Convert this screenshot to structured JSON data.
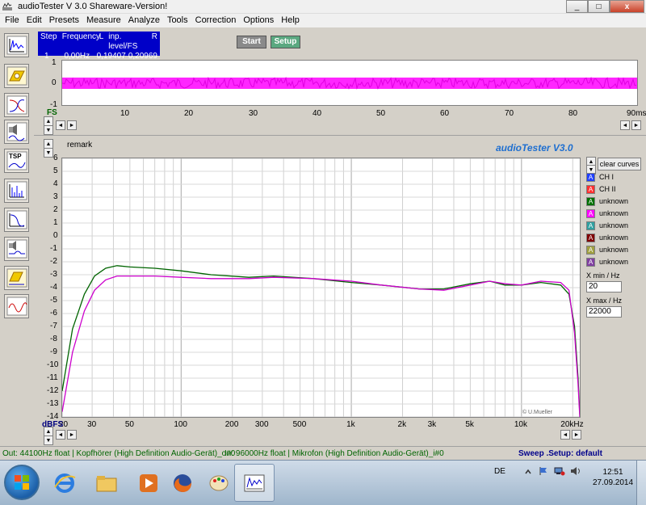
{
  "window": {
    "title": "audioTester  V 3.0 Shareware-Version!",
    "minimize_label": "_",
    "maximize_label": "□",
    "close_label": "x"
  },
  "menu": [
    "File",
    "Edit",
    "Presets",
    "Measure",
    "Analyze",
    "Tools",
    "Correction",
    "Options",
    "Help"
  ],
  "toolbar": {
    "tsp_label": "TSP",
    "tools": [
      "oscilloscope-tool",
      "speaker-tool",
      "filter-tool",
      "impulse-tool",
      "tsp-tool",
      "spectrum-tool",
      "response-tool",
      "phase-tool",
      "speaker-response-tool",
      "waterfall-tool"
    ]
  },
  "info": {
    "header": [
      "Step",
      "Frequency",
      "L",
      "inp. level/FS",
      "R"
    ],
    "values": [
      "1",
      "0,00Hz",
      "0,19407",
      "0,20969"
    ]
  },
  "buttons": {
    "start": "Start",
    "setup": "Setup",
    "clear_curves": "clear curves"
  },
  "time_axis": {
    "y_ticks": [
      "1",
      "0",
      "-1"
    ],
    "x_ticks": [
      "10",
      "20",
      "30",
      "40",
      "50",
      "60",
      "70",
      "80",
      "90ms"
    ],
    "fs_label": "FS",
    "trace_color": "#ff00ff"
  },
  "remark_label": "remark",
  "brand_label": "audioTester  V3.0",
  "watermark": "© U.Mueller",
  "chart_data": {
    "type": "line",
    "xlabel": "",
    "ylabel": "dBFS",
    "x_scale": "log",
    "xlim": [
      20,
      22000
    ],
    "ylim": [
      -14,
      6
    ],
    "x_tick_labels": [
      "20",
      "30",
      "50",
      "100",
      "200",
      "300",
      "500",
      "1k",
      "2k",
      "3k",
      "5k",
      "10k",
      "20kHz"
    ],
    "x_tick_values": [
      20,
      30,
      50,
      100,
      200,
      300,
      500,
      1000,
      2000,
      3000,
      5000,
      10000,
      20000
    ],
    "y_ticks": [
      6,
      5,
      4,
      3,
      2,
      1,
      0,
      -1,
      -2,
      -3,
      -4,
      -5,
      -6,
      -7,
      -8,
      -9,
      -10,
      -11,
      -12,
      -13,
      -14
    ],
    "grid": true,
    "series": [
      {
        "name": "",
        "color": "#006400",
        "points": [
          [
            20,
            -12.0
          ],
          [
            23,
            -7.2
          ],
          [
            27,
            -4.5
          ],
          [
            31,
            -3.1
          ],
          [
            36,
            -2.5
          ],
          [
            42,
            -2.3
          ],
          [
            50,
            -2.4
          ],
          [
            70,
            -2.5
          ],
          [
            100,
            -2.7
          ],
          [
            150,
            -3.0
          ],
          [
            250,
            -3.2
          ],
          [
            350,
            -3.1
          ],
          [
            600,
            -3.3
          ],
          [
            1000,
            -3.6
          ],
          [
            1500,
            -3.8
          ],
          [
            2500,
            -4.1
          ],
          [
            3500,
            -4.1
          ],
          [
            5000,
            -3.7
          ],
          [
            6500,
            -3.5
          ],
          [
            8000,
            -3.8
          ],
          [
            10000,
            -3.8
          ],
          [
            13000,
            -3.6
          ],
          [
            17000,
            -3.8
          ],
          [
            19000,
            -4.5
          ],
          [
            20500,
            -7.0
          ],
          [
            21500,
            -11.0
          ],
          [
            22000,
            -13.8
          ]
        ]
      },
      {
        "name": "",
        "color": "#cc00cc",
        "points": [
          [
            20,
            -13.6
          ],
          [
            23,
            -9.0
          ],
          [
            27,
            -5.8
          ],
          [
            31,
            -4.2
          ],
          [
            36,
            -3.4
          ],
          [
            42,
            -3.1
          ],
          [
            50,
            -3.1
          ],
          [
            70,
            -3.1
          ],
          [
            100,
            -3.2
          ],
          [
            150,
            -3.3
          ],
          [
            250,
            -3.3
          ],
          [
            350,
            -3.2
          ],
          [
            600,
            -3.3
          ],
          [
            1000,
            -3.5
          ],
          [
            1500,
            -3.8
          ],
          [
            2500,
            -4.1
          ],
          [
            3500,
            -4.2
          ],
          [
            5000,
            -3.8
          ],
          [
            6500,
            -3.5
          ],
          [
            8000,
            -3.7
          ],
          [
            10000,
            -3.8
          ],
          [
            13000,
            -3.5
          ],
          [
            17000,
            -3.6
          ],
          [
            19000,
            -4.2
          ],
          [
            20500,
            -7.5
          ],
          [
            21500,
            -11.5
          ],
          [
            22000,
            -14.0
          ]
        ]
      }
    ]
  },
  "legend": [
    {
      "label": "CH I",
      "color": "#2040ff"
    },
    {
      "label": "CH II",
      "color": "#ff3030"
    },
    {
      "label": "unknown",
      "color": "#007000"
    },
    {
      "label": "unknown",
      "color": "#ff00ff"
    },
    {
      "label": "unknown",
      "color": "#30a0a0"
    },
    {
      "label": "unknown",
      "color": "#800000"
    },
    {
      "label": "unknown",
      "color": "#a0a040"
    },
    {
      "label": "unknown",
      "color": "#8040a0"
    }
  ],
  "range": {
    "xmin_label": "X min / Hz",
    "xmin_value": "20",
    "xmax_label": "X max / Hz",
    "xmax_value": "22000"
  },
  "status": {
    "out": "Out: 44100Hz float  |  Kopfhörer (High Definition Audio-Gerät)_o#0",
    "in": "In: 96000Hz float  |  Mikrofon (High Definition Audio-Gerät)_i#0",
    "sweep": "Sweep  .Setup: default"
  },
  "taskbar": {
    "lang": "DE",
    "time": "12:51",
    "date": "27.09.2014",
    "apps": [
      "internet-explorer",
      "file-explorer",
      "media-player",
      "firefox",
      "paint",
      "audiotester"
    ]
  }
}
